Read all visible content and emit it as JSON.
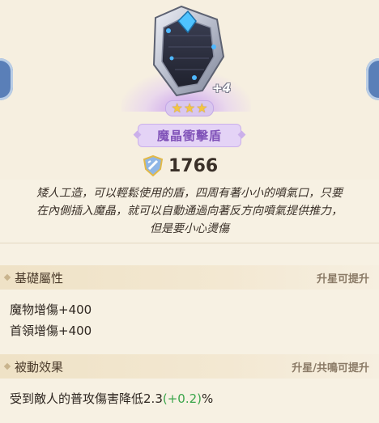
{
  "item": {
    "name": "魔晶衝擊盾",
    "level_badge": "+4",
    "stars": 3,
    "star_glyph": "★",
    "power": "1766",
    "description_lines": [
      "矮人工造，可以輕鬆使用的盾，四周有著小小的噴氣口，只要",
      "在內側插入魔晶，就可以自動通過向著反方向噴氣提供推力，",
      "但是要小心燙傷"
    ]
  },
  "base_attributes": {
    "title": "基礎屬性",
    "hint": "升星可提升",
    "stats": [
      "魔物增傷+400",
      "首領增傷+400"
    ]
  },
  "passive": {
    "title": "被動效果",
    "hint": "升星/共鳴可提升",
    "effect_prefix": "受到敵人的普攻傷害降低2.3",
    "effect_bonus": "(+0.2)",
    "effect_suffix": "%"
  },
  "colors": {
    "background": "#f7f1e3",
    "name_text": "#8052b8",
    "bonus_green": "#3aa54a",
    "side_nav": "#5a7fb8"
  },
  "icons": [
    "shield-item-art",
    "power-shield-icon",
    "star-icon",
    "nav-left-icon",
    "nav-right-icon"
  ]
}
